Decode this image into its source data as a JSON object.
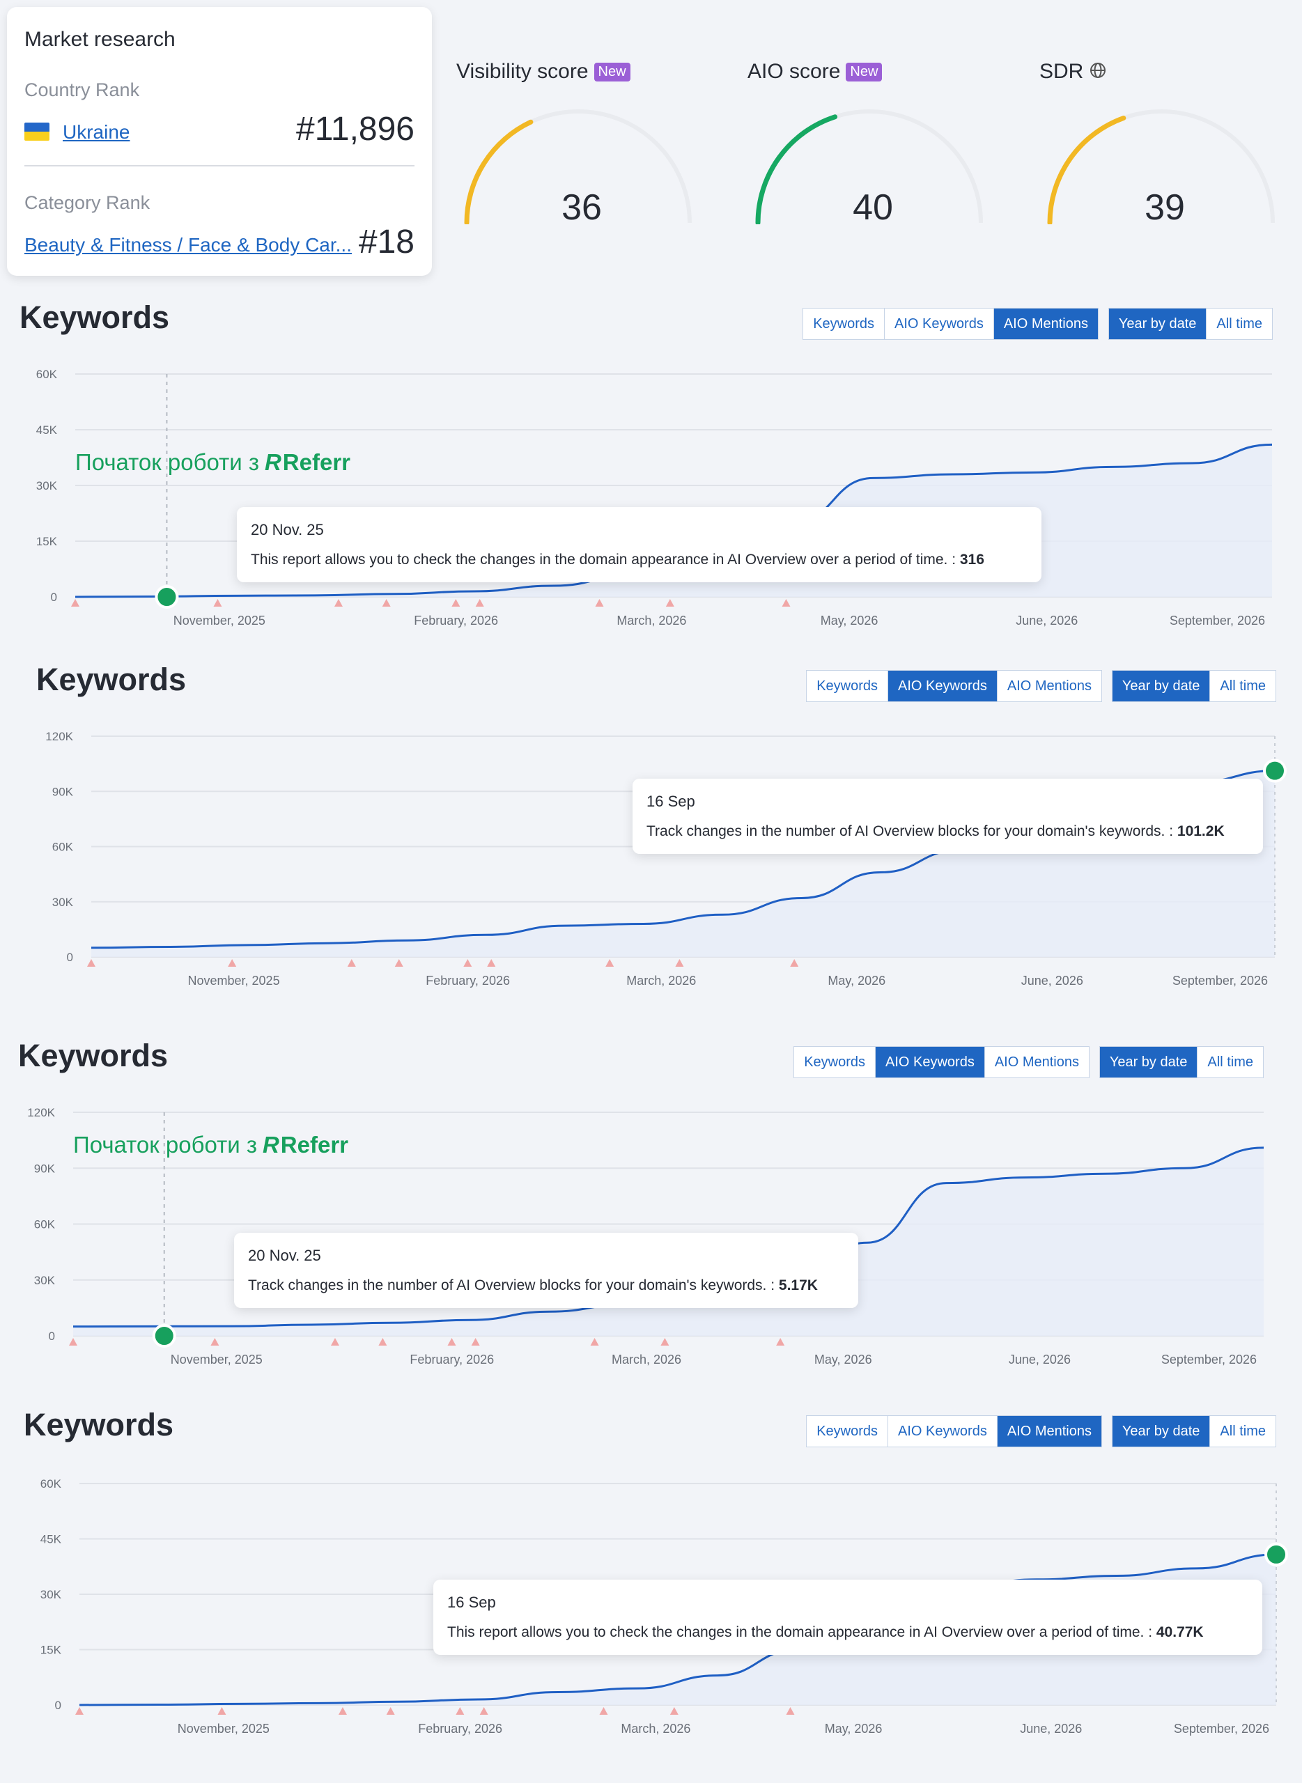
{
  "market_research": {
    "title": "Market research",
    "country_rank_label": "Country Rank",
    "country": "Ukraine",
    "country_rank": "#11,896",
    "category_rank_label": "Category Rank",
    "category": "Beauty & Fitness / Face & Body Car...",
    "category_rank": "#18"
  },
  "gauges": [
    {
      "label": "Visibility score",
      "badge": "New",
      "value": 36,
      "color": "#f2b824"
    },
    {
      "label": "AIO score",
      "badge": "New",
      "value": 40,
      "color": "#16a862"
    },
    {
      "label": "SDR",
      "badge": "",
      "value": 39,
      "color": "#f2b824",
      "icon": "globe-icon"
    }
  ],
  "segment_labels": {
    "keywords": "Keywords",
    "aio_keywords": "AIO Keywords",
    "aio_mentions": "AIO Mentions",
    "year_by_date": "Year by date",
    "all_time": "All time"
  },
  "referr_marker": {
    "prefix": "Початок роботи з",
    "brand": "Referr",
    "logo_letter": "R"
  },
  "colors": {
    "line": "#1f5fc4",
    "fill": "#e6ecf8",
    "marker": "#17a05d",
    "event_triangle": "#f0a6a6",
    "accent": "#1f66c2"
  },
  "charts": [
    {
      "title": "Keywords",
      "active_metric": "AIO Mentions",
      "active_period": "Year by date",
      "show_referr": true,
      "tooltip": {
        "date": "20 Nov. 25",
        "text": "This report allows you to check the changes in the domain appearance in AI Overview over a period of time. : ",
        "value": "316"
      },
      "chart_data": {
        "type": "area",
        "y_ticks": [
          "60K",
          "45K",
          "30K",
          "15K",
          "0"
        ],
        "ylim": [
          0,
          60000
        ],
        "x_ticks": [
          "November, 2025",
          "February, 2026",
          "March, 2026",
          "May, 2026",
          "June, 2026",
          "September, 2026"
        ],
        "series": [
          {
            "values": [
              0,
              100,
              316,
              400,
              800,
              1500,
              3000,
              6000,
              10000,
              20000,
              32000,
              33000,
              33500,
              35000,
              36000,
              41000
            ]
          }
        ],
        "marker_index": 2
      }
    },
    {
      "title": "Keywords",
      "active_metric": "AIO Keywords",
      "active_period": "Year by date",
      "show_referr": false,
      "tooltip": {
        "date": "16 Sep",
        "text": "Track changes in the number of AI Overview blocks for your domain's keywords. : ",
        "value": "101.2K"
      },
      "chart_data": {
        "type": "area",
        "y_ticks": [
          "120K",
          "90K",
          "60K",
          "30K",
          "0"
        ],
        "ylim": [
          0,
          120000
        ],
        "x_ticks": [
          "November, 2025",
          "February, 2026",
          "March, 2026",
          "May, 2026",
          "June, 2026",
          "September, 2026"
        ],
        "series": [
          {
            "values": [
              5000,
              5500,
              6500,
              7500,
              9000,
              12000,
              17000,
              18000,
              23000,
              32000,
              46000,
              58000,
              75000,
              88000,
              95000,
              101200
            ]
          }
        ],
        "marker_index": 15
      }
    },
    {
      "title": "Keywords",
      "active_metric": "AIO Keywords",
      "active_period": "Year by date",
      "show_referr": true,
      "tooltip": {
        "date": "20 Nov. 25",
        "text": "Track changes in the number of AI Overview blocks for your domain's keywords. : ",
        "value": "5.17K"
      },
      "chart_data": {
        "type": "area",
        "y_ticks": [
          "120K",
          "90K",
          "60K",
          "30K",
          "0"
        ],
        "ylim": [
          0,
          120000
        ],
        "x_ticks": [
          "November, 2025",
          "February, 2026",
          "March, 2026",
          "May, 2026",
          "June, 2026",
          "September, 2026"
        ],
        "series": [
          {
            "values": [
              5000,
              5100,
              5170,
              6000,
              7000,
              8500,
              13000,
              17000,
              22000,
              30000,
              50000,
              82000,
              85000,
              87000,
              90000,
              101000
            ]
          }
        ],
        "marker_index": 2
      }
    },
    {
      "title": "Keywords",
      "active_metric": "AIO Mentions",
      "active_period": "Year by date",
      "show_referr": false,
      "tooltip": {
        "date": "16 Sep",
        "text": "This report allows you to check the changes in the domain appearance in AI Overview over a period of time. : ",
        "value": "40.77K"
      },
      "chart_data": {
        "type": "area",
        "y_ticks": [
          "60K",
          "45K",
          "30K",
          "15K",
          "0"
        ],
        "ylim": [
          0,
          60000
        ],
        "x_ticks": [
          "November, 2025",
          "February, 2026",
          "March, 2026",
          "May, 2026",
          "June, 2026",
          "September, 2026"
        ],
        "series": [
          {
            "values": [
              0,
              100,
              300,
              500,
              900,
              1500,
              3500,
              4500,
              8000,
              15000,
              26000,
              32000,
              34000,
              35000,
              37000,
              40770
            ]
          }
        ],
        "marker_index": 15
      }
    }
  ]
}
